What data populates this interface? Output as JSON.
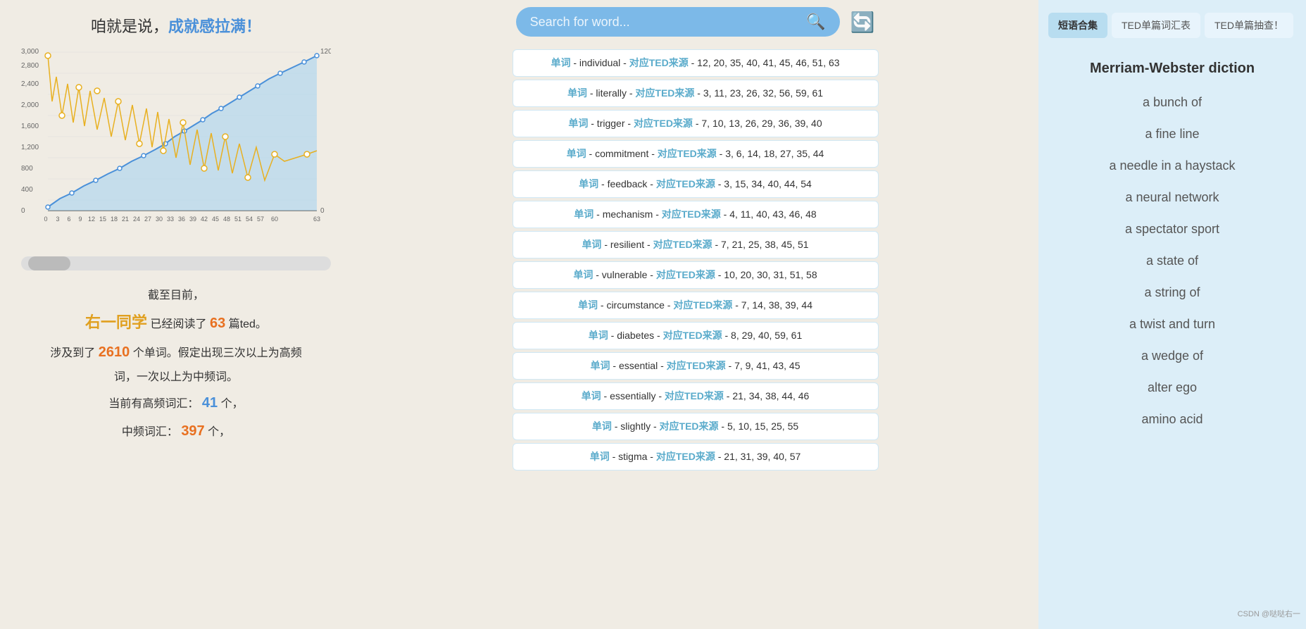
{
  "left": {
    "title_prefix": "咱就是说，",
    "title_highlight": "成就感拉满！",
    "chart": {
      "y_labels": [
        "3,000",
        "2,800",
        "2,400",
        "2,000",
        "1,600",
        "1,200",
        "800",
        "400",
        "0"
      ],
      "y2_labels": [
        "120",
        "",
        "",
        "",
        "",
        "",
        "",
        "",
        "0"
      ],
      "x_labels": [
        "0",
        "3",
        "6",
        "9",
        "12",
        "15",
        "18",
        "21",
        "24",
        "27",
        "30",
        "33",
        "36",
        "39",
        "42",
        "45",
        "48",
        "51",
        "54",
        "57",
        "60",
        "63"
      ]
    },
    "stats": {
      "label1": "截至目前，",
      "name": "右一同学",
      "read_prefix": "已经阅读了",
      "read_count": "63",
      "read_suffix": "篇ted。",
      "words_desc": "涉及到了",
      "word_count": "2610",
      "words_desc2": "个单词。假定出现三次以上为高频词，一次以上为中频词。",
      "high_freq_prefix": "当前有高频词汇：",
      "high_freq_count": "41",
      "high_freq_suffix": "个，",
      "mid_freq_prefix": "中频词汇：",
      "mid_freq_count": "397",
      "mid_freq_suffix": "个，"
    }
  },
  "center": {
    "search_placeholder": "Search for word...",
    "words": [
      {
        "label": "单词",
        "word": "individual",
        "source_label": "对应TED来源",
        "numbers": "12, 20, 35, 40, 41, 45, 46, 51, 63"
      },
      {
        "label": "单词",
        "word": "literally",
        "source_label": "对应TED来源",
        "numbers": "3, 11, 23, 26, 32, 56, 59, 61"
      },
      {
        "label": "单词",
        "word": "trigger",
        "source_label": "对应TED来源",
        "numbers": "7, 10, 13, 26, 29, 36, 39, 40"
      },
      {
        "label": "单词",
        "word": "commitment",
        "source_label": "对应TED来源",
        "numbers": "3, 6, 14, 18, 27, 35, 44"
      },
      {
        "label": "单词",
        "word": "feedback",
        "source_label": "对应TED来源",
        "numbers": "3, 15, 34, 40, 44, 54"
      },
      {
        "label": "单词",
        "word": "mechanism",
        "source_label": "对应TED来源",
        "numbers": "4, 11, 40, 43, 46, 48"
      },
      {
        "label": "单词",
        "word": "resilient",
        "source_label": "对应TED来源",
        "numbers": "7, 21, 25, 38, 45, 51"
      },
      {
        "label": "单词",
        "word": "vulnerable",
        "source_label": "对应TED来源",
        "numbers": "10, 20, 30, 31, 51, 58"
      },
      {
        "label": "单词",
        "word": "circumstance",
        "source_label": "对应TED来源",
        "numbers": "7, 14, 38, 39, 44"
      },
      {
        "label": "单词",
        "word": "diabetes",
        "source_label": "对应TED来源",
        "numbers": "8, 29, 40, 59, 61"
      },
      {
        "label": "单词",
        "word": "essential",
        "source_label": "对应TED来源",
        "numbers": "7, 9, 41, 43, 45"
      },
      {
        "label": "单词",
        "word": "essentially",
        "source_label": "对应TED来源",
        "numbers": "21, 34, 38, 44, 46"
      },
      {
        "label": "单词",
        "word": "slightly",
        "source_label": "对应TED来源",
        "numbers": "5, 10, 15, 25, 55"
      },
      {
        "label": "单词",
        "word": "stigma",
        "source_label": "对应TED来源",
        "numbers": "21, 31, 39, 40, 57"
      }
    ]
  },
  "right": {
    "tabs": [
      {
        "label": "短语合集",
        "active": true
      },
      {
        "label": "TED单篇词汇表",
        "active": false
      },
      {
        "label": "TED单篇抽查！",
        "active": false
      }
    ],
    "phrases": [
      {
        "text": "Merriam-Webster diction",
        "is_header": true
      },
      {
        "text": "a bunch of",
        "is_header": false
      },
      {
        "text": "a fine line",
        "is_header": false
      },
      {
        "text": "a needle in a haystack",
        "is_header": false
      },
      {
        "text": "a neural network",
        "is_header": false
      },
      {
        "text": "a spectator sport",
        "is_header": false
      },
      {
        "text": "a state of",
        "is_header": false
      },
      {
        "text": "a string of",
        "is_header": false
      },
      {
        "text": "a twist and turn",
        "is_header": false
      },
      {
        "text": "a wedge of",
        "is_header": false
      },
      {
        "text": "alter ego",
        "is_header": false
      },
      {
        "text": "amino acid",
        "is_header": false
      }
    ],
    "watermark": "CSDN @哒哒右一"
  }
}
